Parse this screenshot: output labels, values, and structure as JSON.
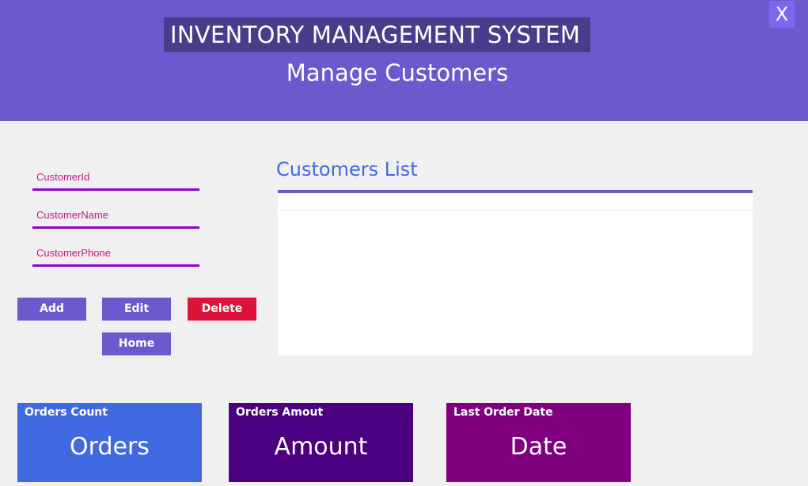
{
  "header": {
    "app_title": "INVENTORY MANAGEMENT SYSTEM",
    "page_title": "Manage Customers",
    "close_label": "X"
  },
  "form": {
    "customer_id": {
      "placeholder": "CustomerId",
      "value": ""
    },
    "customer_name": {
      "placeholder": "CustomerName",
      "value": ""
    },
    "customer_phone": {
      "placeholder": "CustomerPhone",
      "value": ""
    }
  },
  "buttons": {
    "add": "Add",
    "edit": "Edit",
    "delete": "Delete",
    "home": "Home"
  },
  "list": {
    "title": "Customers List",
    "rows": []
  },
  "cards": {
    "orders_count": {
      "label": "Orders Count",
      "value": "Orders",
      "color": "#4169e1"
    },
    "orders_amount": {
      "label": "Orders Amout",
      "value": "Amount",
      "color": "#4b0082"
    },
    "last_order": {
      "label": "Last Order Date",
      "value": "Date",
      "color": "#800080"
    }
  },
  "colors": {
    "header": "#6a5acd",
    "title_box": "#483d8b",
    "accent_line": "#9400d3",
    "delete": "#dc143c",
    "list_title": "#4169e1"
  }
}
